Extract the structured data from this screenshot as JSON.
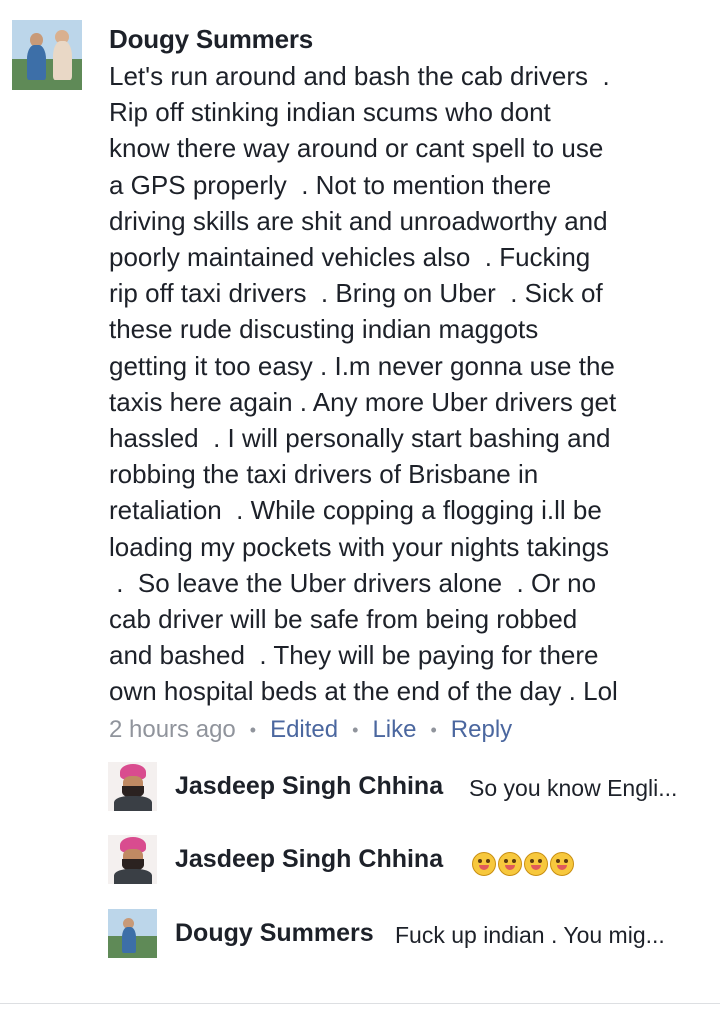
{
  "comment": {
    "author": "Dougy Summers",
    "text_lines": [
      "Let's run around and bash the cab drivers  .",
      "Rip off stinking indian scums who dont",
      "know there way around or cant spell to use",
      "a GPS properly  . Not to mention there",
      "driving skills are shit and unroadworthy and",
      "poorly maintained vehicles also  . Fucking",
      "rip off taxi drivers  . Bring on Uber  . Sick of",
      "these rude discusting indian maggots",
      "getting it too easy . I.m never gonna use the",
      "taxis here again . Any more Uber drivers get",
      "hassled  . I will personally start bashing and",
      "robbing the taxi drivers of Brisbane in",
      "retaliation  . While copping a flogging i.ll be",
      "loading my pockets with your nights takings",
      " .  So leave the Uber drivers alone  . Or no",
      "cab driver will be safe from being robbed",
      "and bashed  . They will be paying for there",
      "own hospital beds at the end of the day . Lol"
    ],
    "meta": {
      "time": "2 hours ago",
      "edited": "Edited",
      "like": "Like",
      "reply": "Reply",
      "separator": "•"
    }
  },
  "replies": [
    {
      "author": "Jasdeep Singh Chhina",
      "text": "So you know Engli...",
      "emoji_count": 0
    },
    {
      "author": "Jasdeep Singh Chhina",
      "text": "",
      "emoji_count": 4
    },
    {
      "author": "Dougy Summers",
      "text": "Fuck up indian  . You mig...",
      "emoji_count": 0
    }
  ],
  "colors": {
    "text": "#1d2129",
    "meta": "#90949c",
    "link": "#4b679f",
    "divider": "#dddfe2"
  }
}
